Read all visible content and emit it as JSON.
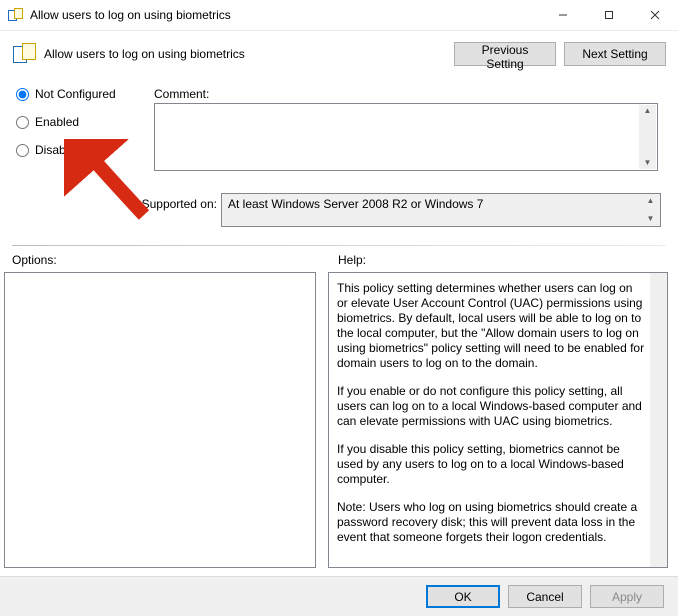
{
  "window": {
    "title": "Allow users to log on using biometrics"
  },
  "header": {
    "title": "Allow users to log on using biometrics",
    "previous": "Previous Setting",
    "next": "Next Setting"
  },
  "state": {
    "not_configured": "Not Configured",
    "enabled": "Enabled",
    "disabled": "Disabled",
    "selected": "not_configured"
  },
  "comment": {
    "label": "Comment:",
    "value": ""
  },
  "supported": {
    "label": "Supported on:",
    "value": "At least Windows Server 2008 R2 or Windows 7"
  },
  "options": {
    "label": "Options:"
  },
  "help": {
    "label": "Help:",
    "paragraphs": [
      "This policy setting determines whether users can log on or elevate User Account Control (UAC) permissions using biometrics.  By default, local users will be able to log on to the local computer, but the \"Allow domain users to log on using biometrics\" policy setting will need to be enabled for domain users to log on to the domain.",
      "If you enable or do not configure this policy setting, all users can log on to a local Windows-based computer and can elevate permissions with UAC using biometrics.",
      "If you disable this policy setting, biometrics cannot be used by any users to log on to a local Windows-based computer.",
      "Note: Users who log on using biometrics should create a password recovery disk; this will prevent data loss in the event that someone forgets their logon credentials."
    ]
  },
  "buttons": {
    "ok": "OK",
    "cancel": "Cancel",
    "apply": "Apply"
  },
  "icons": {
    "arrow_color": "#d62a12"
  }
}
